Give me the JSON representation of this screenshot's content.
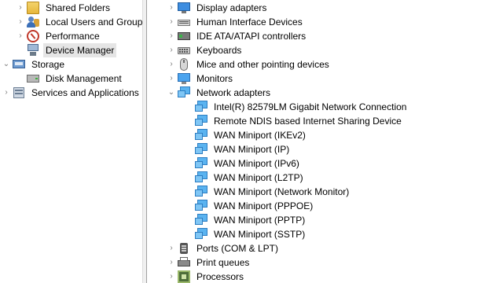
{
  "left_tree": {
    "items": [
      {
        "label": "Shared Folders",
        "expander": "›",
        "icon": "shared-folder-icon"
      },
      {
        "label": "Local Users and Groups",
        "expander": "›",
        "icon": "users-icon"
      },
      {
        "label": "Performance",
        "expander": "›",
        "icon": "performance-icon"
      },
      {
        "label": "Device Manager",
        "expander": "",
        "icon": "device-manager-icon",
        "selected": true
      },
      {
        "label": "Storage",
        "expander": "⌄",
        "icon": "storage-icon"
      },
      {
        "label": "Disk Management",
        "expander": "",
        "icon": "disk-icon"
      },
      {
        "label": "Services and Applications",
        "expander": "›",
        "icon": "services-icon"
      }
    ]
  },
  "device_tree": {
    "categories": [
      {
        "label": "Display adapters",
        "expander": "›",
        "icon": "display-adapter-icon"
      },
      {
        "label": "Human Interface Devices",
        "expander": "›",
        "icon": "hid-icon"
      },
      {
        "label": "IDE ATA/ATAPI controllers",
        "expander": "›",
        "icon": "ide-controller-icon"
      },
      {
        "label": "Keyboards",
        "expander": "›",
        "icon": "keyboard-icon"
      },
      {
        "label": "Mice and other pointing devices",
        "expander": "›",
        "icon": "mouse-icon"
      },
      {
        "label": "Monitors",
        "expander": "›",
        "icon": "monitor-icon"
      },
      {
        "label": "Network adapters",
        "expander": "⌄",
        "icon": "network-adapter-icon"
      }
    ],
    "network_children": [
      "Intel(R) 82579LM Gigabit Network Connection",
      "Remote NDIS based Internet Sharing Device",
      "WAN Miniport (IKEv2)",
      "WAN Miniport (IP)",
      "WAN Miniport (IPv6)",
      "WAN Miniport (L2TP)",
      "WAN Miniport (Network Monitor)",
      "WAN Miniport (PPPOE)",
      "WAN Miniport (PPTP)",
      "WAN Miniport (SSTP)"
    ],
    "after": [
      {
        "label": "Ports (COM & LPT)",
        "expander": "›",
        "icon": "ports-icon"
      },
      {
        "label": "Print queues",
        "expander": "›",
        "icon": "printer-icon"
      },
      {
        "label": "Processors",
        "expander": "›",
        "icon": "processor-icon"
      }
    ]
  }
}
